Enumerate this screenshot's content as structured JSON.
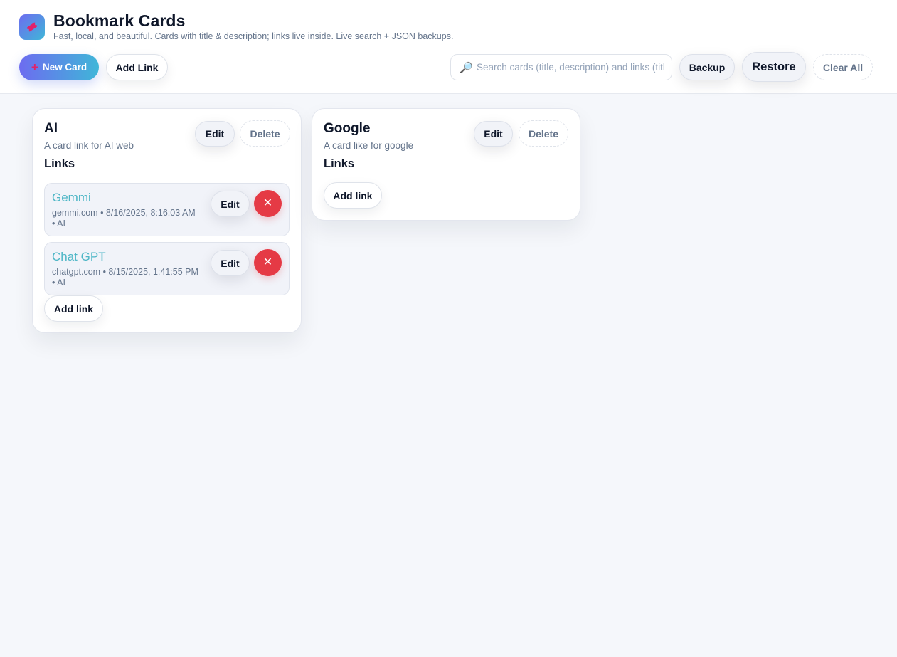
{
  "header": {
    "app_icon": "ticket-icon",
    "title": "Bookmark Cards",
    "subtitle": "Fast, local, and beautiful. Cards with title & description; links live inside. Live search + JSON backups.",
    "new_card_label": "New Card",
    "add_link_label": "Add Link",
    "search_placeholder": "Search cards (title, description) and links (title, url, tags)",
    "search_value": "",
    "backup_label": "Backup",
    "restore_label": "Restore",
    "clear_all_label": "Clear All"
  },
  "cards": [
    {
      "title": "AI",
      "description": "A card link for AI web",
      "links_label": "Links",
      "edit_label": "Edit",
      "delete_label": "Delete",
      "links": [
        {
          "title": "Gemmi",
          "meta_line1": "gemmi.com • 8/16/2025, 8:16:03 AM",
          "meta_line2": "• AI",
          "edit_label": "Edit",
          "delete_symbol": "✕"
        },
        {
          "title": "Chat GPT",
          "meta_line1": "chatgpt.com • 8/15/2025, 1:41:55 PM",
          "meta_line2": "• AI",
          "edit_label": "Edit",
          "delete_symbol": "✕"
        }
      ],
      "add_link_label": "Add link"
    },
    {
      "title": "Google",
      "description": "A card like for google",
      "links_label": "Links",
      "edit_label": "Edit",
      "delete_label": "Delete",
      "links": [],
      "add_link_label": "Add link"
    }
  ],
  "colors": {
    "accent_gradient_start": "#6d6cf0",
    "accent_gradient_end": "#3fb6d8",
    "link_title": "#4db6c6",
    "danger": "#e53a45",
    "background": "#f5f7fb"
  }
}
